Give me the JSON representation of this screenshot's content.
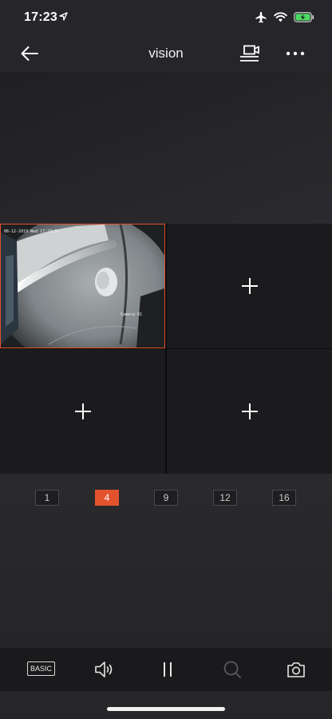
{
  "status_bar": {
    "time": "17:23",
    "icons": [
      "location-arrow-icon",
      "airplane-icon",
      "wifi-icon",
      "battery-charging-icon"
    ],
    "battery_color": "#4cd964"
  },
  "nav": {
    "title": "vision",
    "left_icon": "back-arrow-icon",
    "right_icons": [
      "device-list-icon",
      "more-icon"
    ]
  },
  "grid": {
    "cells": [
      {
        "type": "camera",
        "timestamp": "06-12-2019 Wed 17:23:31",
        "camera_name": "Camera 01"
      },
      {
        "type": "empty",
        "icon": "plus-icon"
      },
      {
        "type": "empty",
        "icon": "plus-icon"
      },
      {
        "type": "empty",
        "icon": "plus-icon"
      }
    ],
    "selected_border_color": "#e2522d"
  },
  "split_options": {
    "items": [
      "1",
      "4",
      "9",
      "12",
      "16"
    ],
    "selected": "4",
    "accent": "#e2522d"
  },
  "toolbar": {
    "basic_label": "BASIC",
    "icons": [
      "basic-stream-button",
      "speaker-icon",
      "pause-icon",
      "search-icon",
      "snapshot-camera-icon"
    ]
  }
}
